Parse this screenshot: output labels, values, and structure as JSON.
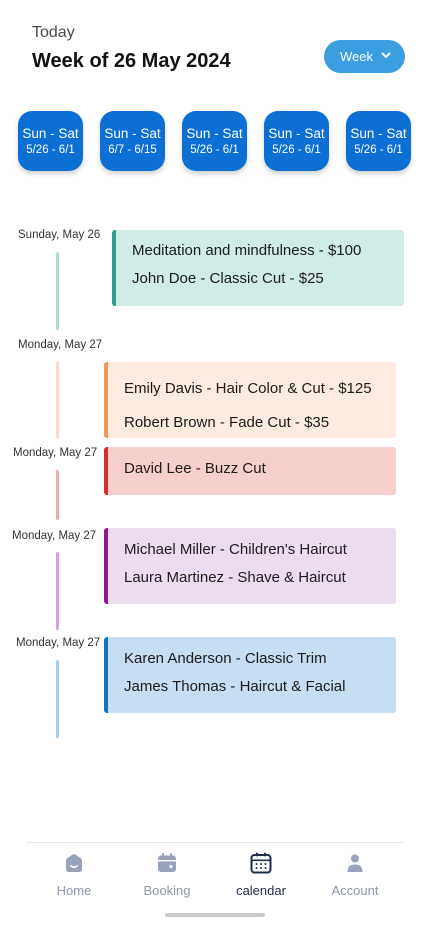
{
  "header": {
    "today_label": "Today",
    "title": "Week of 26 May 2024",
    "week_dropdown": {
      "label": "Week",
      "icon": "chevron-down-icon"
    }
  },
  "week_cards": [
    {
      "days": "Sun - Sat",
      "range": "5/26 - 6/1"
    },
    {
      "days": "Sun - Sat",
      "range": "6/7 - 6/15"
    },
    {
      "days": "Sun - Sat",
      "range": "5/26 - 6/1"
    },
    {
      "days": "Sun - Sat",
      "range": "5/26 - 6/1"
    },
    {
      "days": "Sun - Sat",
      "range": "5/26 - 6/1"
    }
  ],
  "schedule": [
    {
      "day": "Sunday, May 26",
      "color": "#2aa08c",
      "fill": "#d1ebe6",
      "line_color": "#a9dccf",
      "events": [
        "Meditation and mindfulness - $100",
        "John Doe - Classic Cut - $25"
      ]
    },
    {
      "day": "Monday, May 27",
      "color": "#f0955a",
      "fill": "#fdebe0",
      "line_color": "#fbdcc8",
      "events": [
        "Emily Davis - Hair Color & Cut - $125",
        "Robert Brown - Fade Cut - $35"
      ]
    },
    {
      "day": "Monday, May 27",
      "color": "#d32f2f",
      "fill": "#f7cfcd",
      "line_color": "#f2aaa4",
      "events": [
        "David Lee - Buzz Cut"
      ]
    },
    {
      "day": "Monday, May 27",
      "color": "#8a1a8e",
      "fill": "#ecdcf0",
      "line_color": "#d1a4d9",
      "events": [
        "Michael Miller - Children's Haircut",
        " Laura Martinez - Shave & Haircut"
      ]
    },
    {
      "day": "Monday, May 27",
      "color": "#1472c4",
      "fill": "#c7ddf2",
      "line_color": "#a7cdee",
      "events": [
        "Karen Anderson - Classic Trim",
        "James Thomas - Haircut & Facial"
      ]
    }
  ],
  "bottom_nav": [
    {
      "label": "Home",
      "icon": "home-icon",
      "active": false
    },
    {
      "label": "Booking",
      "icon": "booking-icon",
      "active": false
    },
    {
      "label": "calendar",
      "icon": "calendar-icon",
      "active": true
    },
    {
      "label": "Account",
      "icon": "account-icon",
      "active": false
    }
  ]
}
